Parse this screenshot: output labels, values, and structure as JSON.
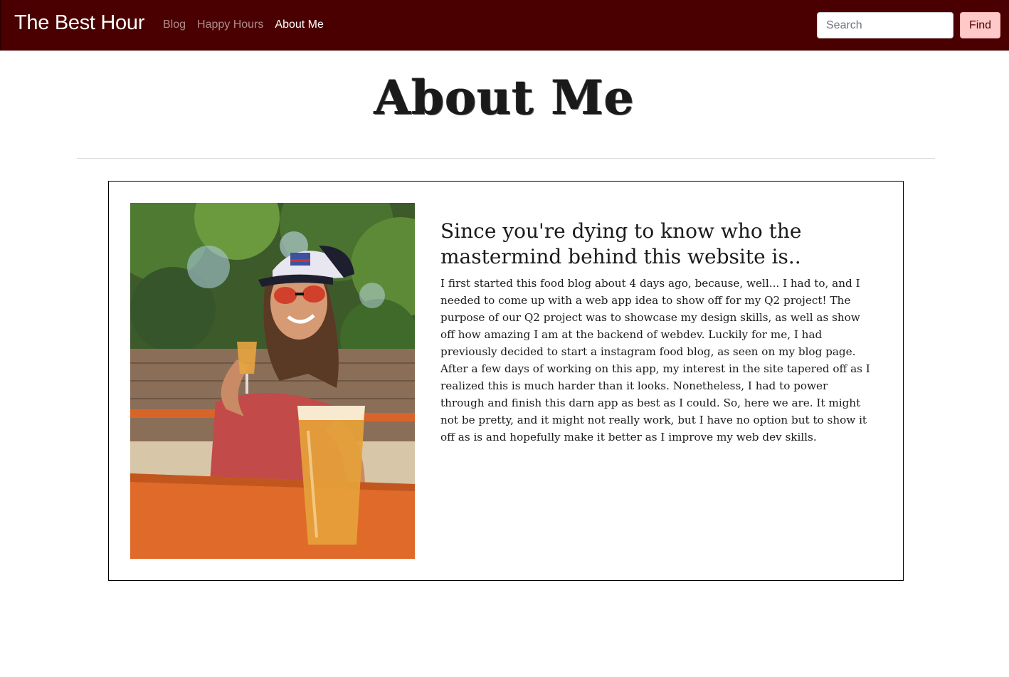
{
  "navbar": {
    "brand": "The Best Hour",
    "links": [
      {
        "label": "Blog",
        "active": false
      },
      {
        "label": "Happy Hours",
        "active": false
      },
      {
        "label": "About Me",
        "active": true
      }
    ],
    "search": {
      "placeholder": "Search",
      "value": ""
    },
    "find_label": "Find"
  },
  "page": {
    "title": "About Me"
  },
  "about": {
    "photo_description": "photo-woman-with-beer",
    "heading": "Since you're dying to know who the mastermind behind this website is..",
    "body": "I first started this food blog about 4 days ago, because, well... I had to, and I needed to come up with a web app idea to show off for my Q2 project! The purpose of our Q2 project was to showcase my design skills, as well as show off how amazing I am at the backend of webdev. Luckily for me, I had previously decided to start a instagram food blog, as seen on my blog page. After a few days of working on this app, my interest in the site tapered off as I realized this is much harder than it looks. Nonetheless, I had to power through and finish this darn app as best as I could. So, here we are. It might not be pretty, and it might not really work, but I have no option but to show it off as is and hopefully make it better as I improve my web dev skills."
  },
  "colors": {
    "navbar_bg": "#4a0000",
    "find_button_bg": "#ffc9c9",
    "nav_link_active": "#ffffff",
    "nav_link_inactive": "#a08080"
  }
}
